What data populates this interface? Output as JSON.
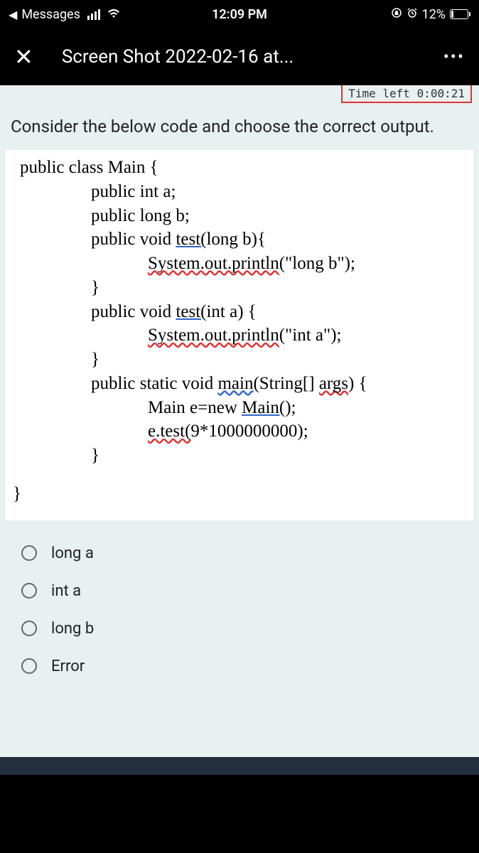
{
  "status": {
    "back_app": "Messages",
    "time": "12:09 PM",
    "battery_pct": "12%"
  },
  "header": {
    "title": "Screen Shot 2022-02-16 at..."
  },
  "timer": {
    "text": "Time left 0:00:21"
  },
  "question": {
    "prompt": "Consider the below code and choose the correct output."
  },
  "code": {
    "l1": "public class Main {",
    "l2": "public int a;",
    "l3": "public long b;",
    "l4_a": "public void ",
    "l4_b": "test(",
    "l4_c": "long b){",
    "l5_a": "System.out.println",
    "l5_b": "(\"long b\");",
    "l6": "}",
    "l7_a": "public void ",
    "l7_b": "test(",
    "l7_c": "int a) {",
    "l8_a": "System.out.println",
    "l8_b": "(\"int a\");",
    "l9": "}",
    "l10_a": "public static void ",
    "l10_b": "main",
    "l10_c": "(String[] ",
    "l10_d": "args",
    "l10_e": ") {",
    "l11_a": "Main e=new ",
    "l11_b": "Main(",
    "l11_c": ");",
    "l12_a": "e.test(",
    "l12_b": "9*1000000000);",
    "l13": "}",
    "l14": "}"
  },
  "options": [
    "long a",
    "int a",
    "long b",
    "Error"
  ]
}
